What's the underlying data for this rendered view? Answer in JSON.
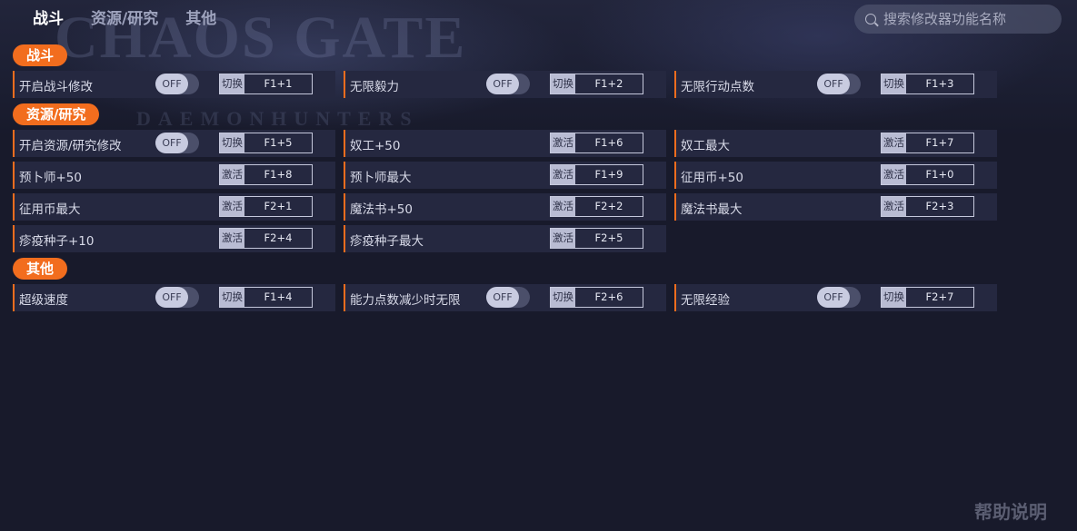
{
  "watermark": {
    "title": "CHAOS GATE",
    "subtitle": "DAEMONHUNTERS"
  },
  "nav": {
    "tabs": [
      "战斗",
      "资源/研究",
      "其他"
    ]
  },
  "search": {
    "placeholder": "搜索修改器功能名称"
  },
  "toggle_state": "OFF",
  "sections": [
    {
      "title": "战斗"
    },
    {
      "title": "资源/研究"
    },
    {
      "title": "其他"
    }
  ],
  "rows": [
    [
      {
        "label": "开启战斗修改",
        "toggle": "OFF",
        "action": "切换",
        "key": "F1+1"
      },
      {
        "label": "无限毅力",
        "toggle": "OFF",
        "action": "切换",
        "key": "F1+2"
      },
      {
        "label": "无限行动点数",
        "toggle": "OFF",
        "action": "切换",
        "key": "F1+3"
      }
    ],
    [
      {
        "label": "开启资源/研究修改",
        "toggle": "OFF",
        "action": "切换",
        "key": "F1+5"
      },
      {
        "label": "奴工+50",
        "action": "激活",
        "key": "F1+6"
      },
      {
        "label": "奴工最大",
        "action": "激活",
        "key": "F1+7"
      }
    ],
    [
      {
        "label": "预卜师+50",
        "action": "激活",
        "key": "F1+8"
      },
      {
        "label": "预卜师最大",
        "action": "激活",
        "key": "F1+9"
      },
      {
        "label": "征用币+50",
        "action": "激活",
        "key": "F1+0"
      }
    ],
    [
      {
        "label": "征用币最大",
        "action": "激活",
        "key": "F2+1"
      },
      {
        "label": "魔法书+50",
        "action": "激活",
        "key": "F2+2"
      },
      {
        "label": "魔法书最大",
        "action": "激活",
        "key": "F2+3"
      }
    ],
    [
      {
        "label": "疹疫种子+10",
        "action": "激活",
        "key": "F2+4"
      },
      {
        "label": "疹疫种子最大",
        "action": "激活",
        "key": "F2+5"
      }
    ],
    [
      {
        "label": "超级速度",
        "toggle": "OFF",
        "action": "切换",
        "key": "F1+4"
      },
      {
        "label": "能力点数减少时无限",
        "toggle": "OFF",
        "action": "切换",
        "key": "F2+6"
      },
      {
        "label": "无限经验",
        "toggle": "OFF",
        "action": "切换",
        "key": "F2+7"
      }
    ]
  ],
  "help": {
    "label": "帮助说明"
  },
  "colors": {
    "accent": "#f26d1e",
    "background": "#181a2b",
    "cell": "#252840"
  }
}
